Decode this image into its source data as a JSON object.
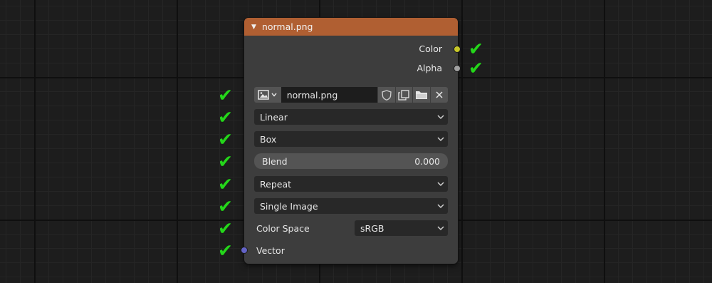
{
  "node": {
    "title": "normal.png",
    "header_color": "#b05f32",
    "outputs": [
      {
        "label": "Color",
        "socket_color": "#c7c729"
      },
      {
        "label": "Alpha",
        "socket_color": "#a1a1a1"
      }
    ],
    "image": {
      "name": "normal.png",
      "browse_icon": "image-browse-icon",
      "fake_user_icon": "shield-icon",
      "duplicate_icon": "duplicate-icon",
      "open_icon": "folder-icon",
      "unlink_icon": "close-icon"
    },
    "interpolation": "Linear",
    "projection": "Box",
    "blend": {
      "label": "Blend",
      "value": "0.000"
    },
    "extension": "Repeat",
    "source": "Single Image",
    "color_space": {
      "label": "Color Space",
      "value": "sRGB"
    },
    "inputs": [
      {
        "label": "Vector",
        "socket_color": "#6363c7"
      }
    ]
  },
  "annotations": {
    "check_icon": "checkmark-icon",
    "check_color": "#25d51b",
    "check_glyph": "✔"
  }
}
